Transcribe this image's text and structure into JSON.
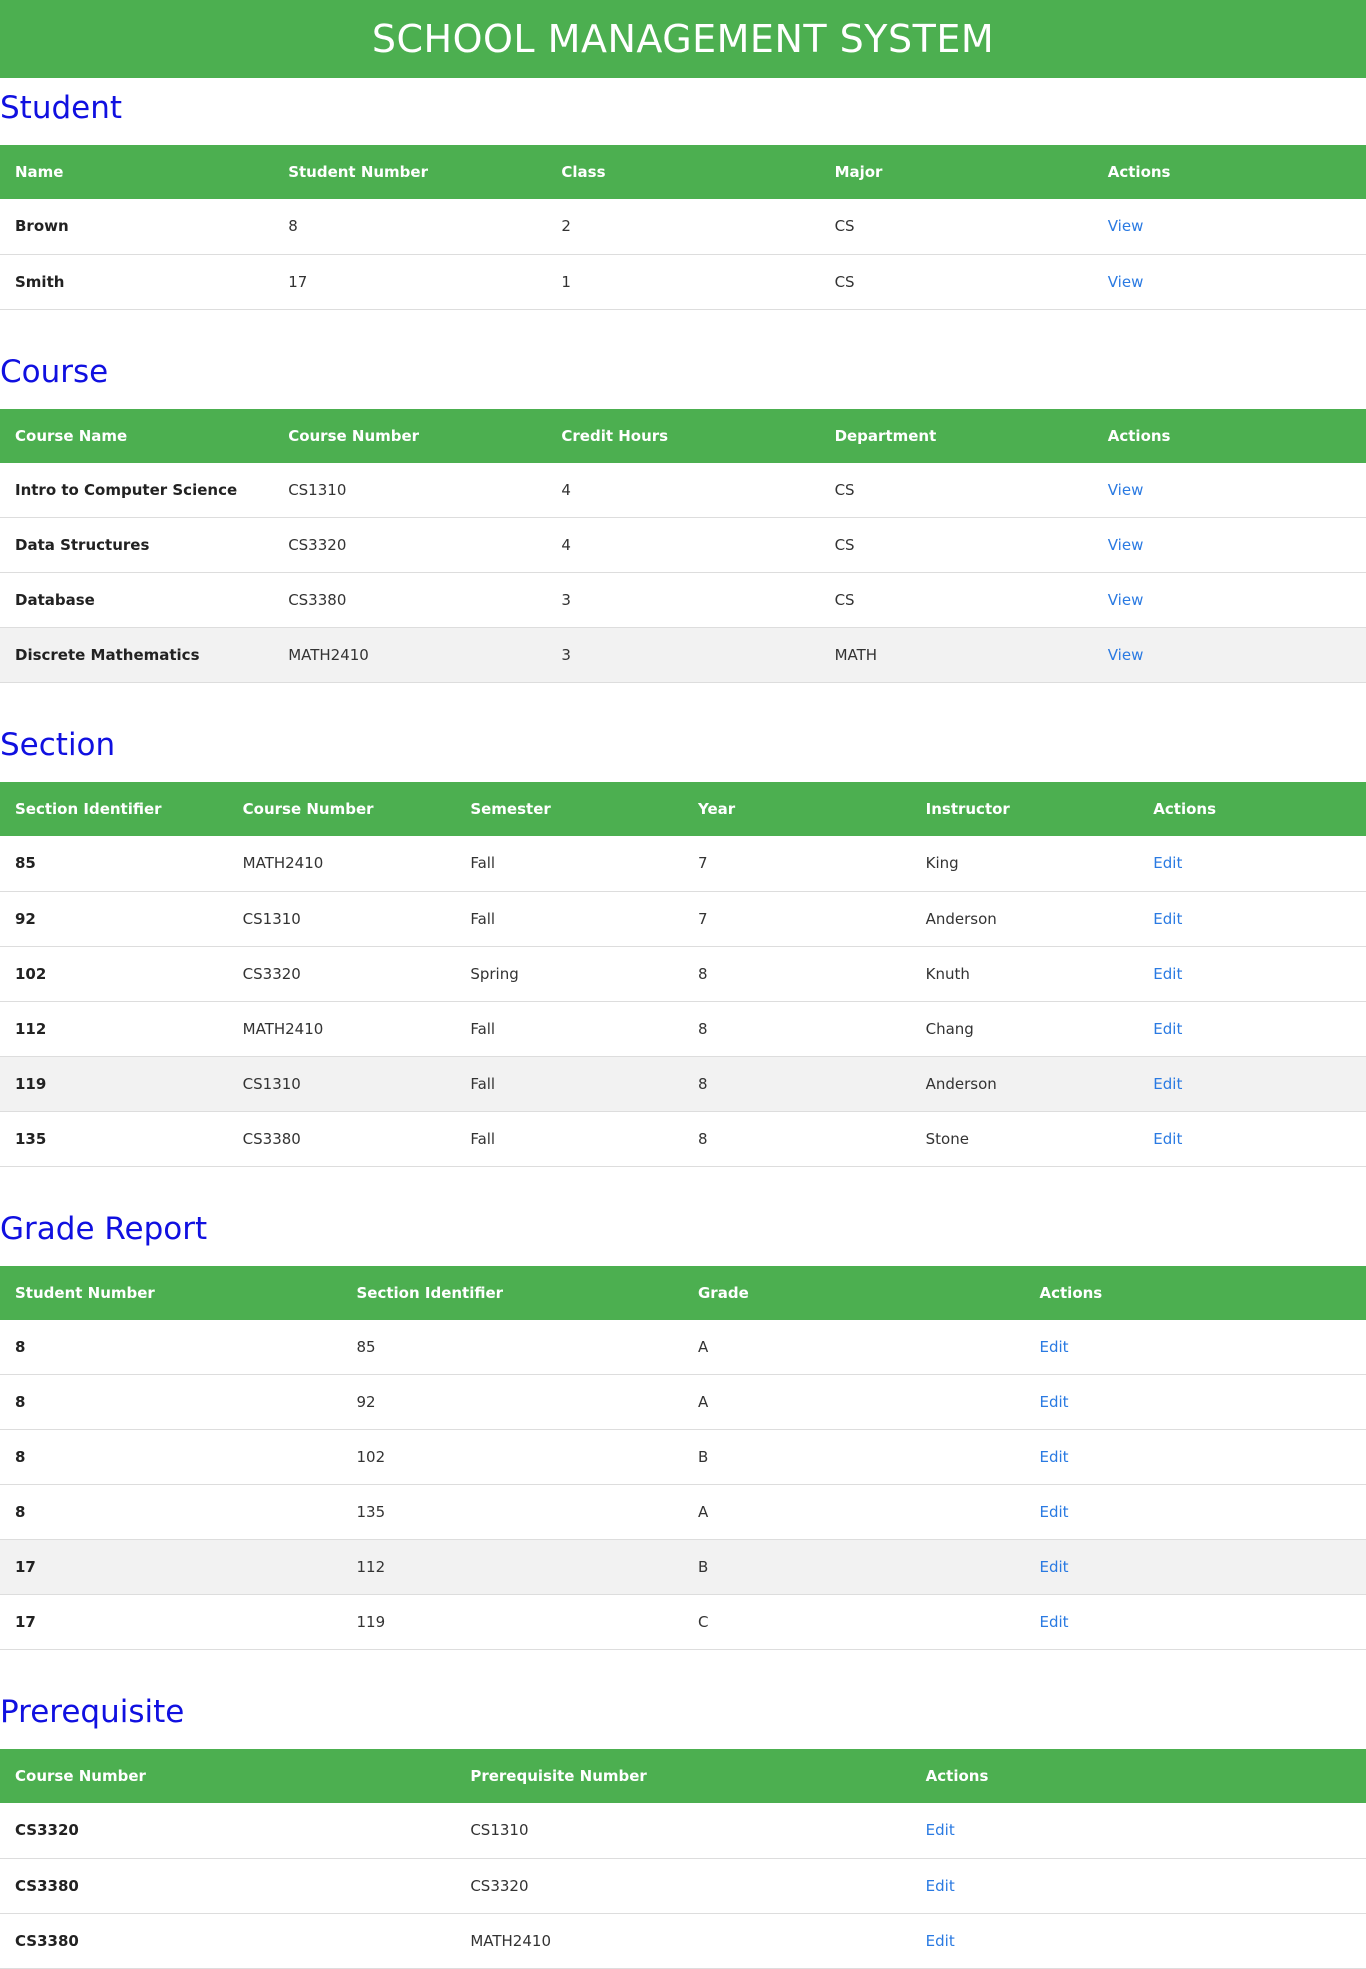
{
  "header": {
    "title": "SCHOOL MANAGEMENT SYSTEM"
  },
  "colors": {
    "header_bg": "#4caf50",
    "section_title": "#1010e0",
    "link": "#2a7ae2"
  },
  "student": {
    "title": "Student",
    "columns": [
      "Name",
      "Student Number",
      "Class",
      "Major",
      "Actions"
    ],
    "rows": [
      [
        "Brown",
        "8",
        "2",
        "CS",
        "View"
      ],
      [
        "Smith",
        "17",
        "1",
        "CS",
        "View"
      ]
    ]
  },
  "course": {
    "title": "Course",
    "columns": [
      "Course Name",
      "Course Number",
      "Credit Hours",
      "Department",
      "Actions"
    ],
    "rows": [
      [
        "Intro to Computer Science",
        "CS1310",
        "4",
        "CS",
        "View"
      ],
      [
        "Data Structures",
        "CS3320",
        "4",
        "CS",
        "View"
      ],
      [
        "Database",
        "CS3380",
        "3",
        "CS",
        "View"
      ],
      [
        "Discrete Mathematics",
        "MATH2410",
        "3",
        "MATH",
        "View"
      ]
    ]
  },
  "section": {
    "title": "Section",
    "columns": [
      "Section Identifier",
      "Course Number",
      "Semester",
      "Year",
      "Instructor",
      "Actions"
    ],
    "rows": [
      [
        "85",
        "MATH2410",
        "Fall",
        "7",
        "King",
        "Edit"
      ],
      [
        "92",
        "CS1310",
        "Fall",
        "7",
        "Anderson",
        "Edit"
      ],
      [
        "102",
        "CS3320",
        "Spring",
        "8",
        "Knuth",
        "Edit"
      ],
      [
        "112",
        "MATH2410",
        "Fall",
        "8",
        "Chang",
        "Edit"
      ],
      [
        "119",
        "CS1310",
        "Fall",
        "8",
        "Anderson",
        "Edit"
      ],
      [
        "135",
        "CS3380",
        "Fall",
        "8",
        "Stone",
        "Edit"
      ]
    ]
  },
  "grade_report": {
    "title": "Grade Report",
    "columns": [
      "Student Number",
      "Section Identifier",
      "Grade",
      "Actions"
    ],
    "rows": [
      [
        "8",
        "85",
        "A",
        "Edit"
      ],
      [
        "8",
        "92",
        "A",
        "Edit"
      ],
      [
        "8",
        "102",
        "B",
        "Edit"
      ],
      [
        "8",
        "135",
        "A",
        "Edit"
      ],
      [
        "17",
        "112",
        "B",
        "Edit"
      ],
      [
        "17",
        "119",
        "C",
        "Edit"
      ]
    ]
  },
  "prerequisite": {
    "title": "Prerequisite",
    "columns": [
      "Course Number",
      "Prerequisite Number",
      "Actions"
    ],
    "rows": [
      [
        "CS3320",
        "CS1310",
        "Edit"
      ],
      [
        "CS3380",
        "CS3320",
        "Edit"
      ],
      [
        "CS3380",
        "MATH2410",
        "Edit"
      ]
    ]
  }
}
